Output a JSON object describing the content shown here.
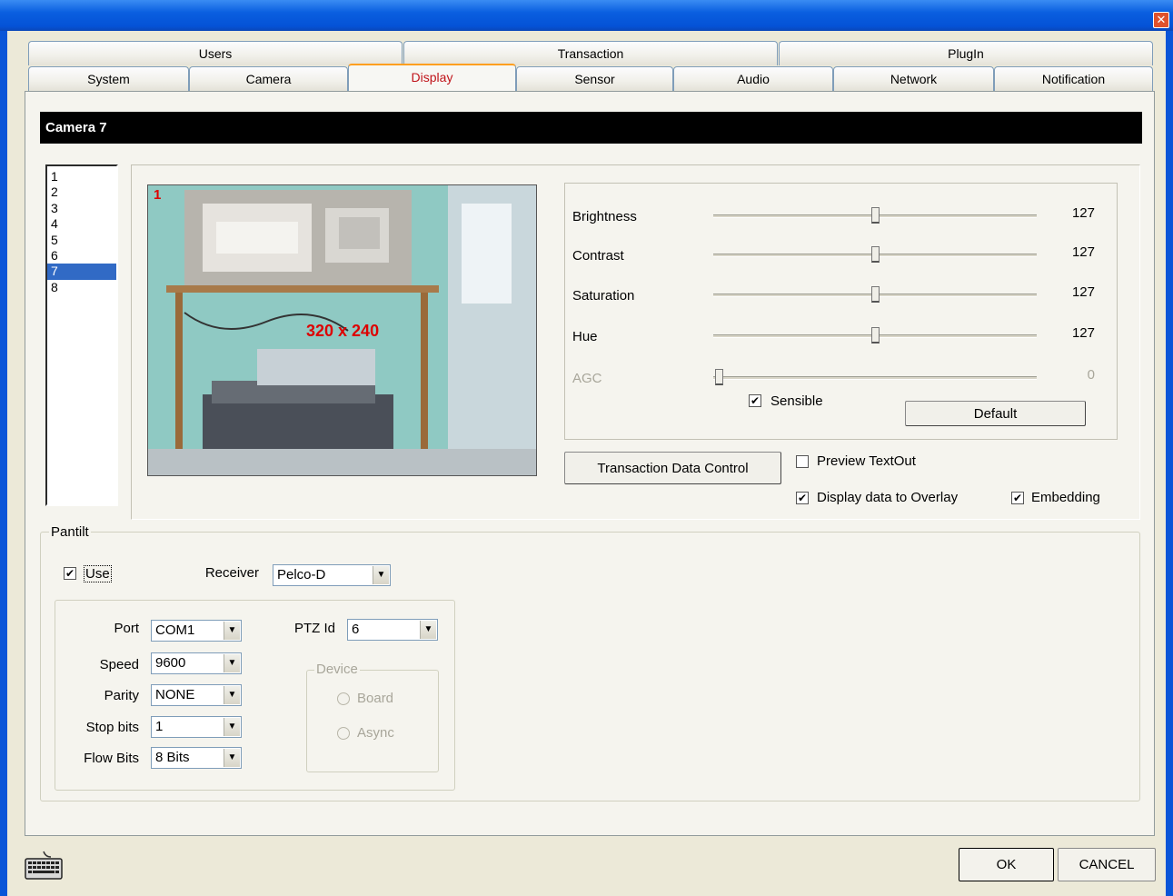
{
  "window": {
    "close_glyph": "✕"
  },
  "tabs_row1": [
    "Users",
    "Transaction",
    "PlugIn"
  ],
  "tabs_row2": [
    "System",
    "Camera",
    "Display",
    "Sensor",
    "Audio",
    "Network",
    "Notification"
  ],
  "camera_header": "Camera 7",
  "camera_list": [
    "1",
    "2",
    "3",
    "4",
    "5",
    "6",
    "7",
    "8"
  ],
  "camera_list_selected": "7",
  "preview": {
    "channel": "1",
    "resolution": "320 x 240"
  },
  "sliders": [
    {
      "label": "Brightness",
      "value": "127",
      "level": 0.5,
      "enabled": true
    },
    {
      "label": "Contrast",
      "value": "127",
      "level": 0.5,
      "enabled": true
    },
    {
      "label": "Saturation",
      "value": "127",
      "level": 0.5,
      "enabled": true
    },
    {
      "label": "Hue",
      "value": "127",
      "level": 0.5,
      "enabled": true
    },
    {
      "label": "AGC",
      "value": "0",
      "level": 0.0,
      "enabled": false
    }
  ],
  "sensible": {
    "label": "Sensible",
    "checked": true
  },
  "default_button": "Default",
  "transaction_button": "Transaction Data Control",
  "preview_textout": {
    "label": "Preview TextOut",
    "checked": false
  },
  "display_overlay": {
    "label": "Display data to Overlay",
    "checked": true
  },
  "embedding": {
    "label": "Embedding",
    "checked": true
  },
  "pantilt": {
    "legend": "Pantilt",
    "use": {
      "label": "Use",
      "checked": true
    },
    "receiver_label": "Receiver",
    "receiver_value": "Pelco-D",
    "port_label": "Port",
    "port_value": "COM1",
    "speed_label": "Speed",
    "speed_value": "9600",
    "parity_label": "Parity",
    "parity_value": "NONE",
    "stopbits_label": "Stop bits",
    "stopbits_value": "1",
    "flowbits_label": "Flow Bits",
    "flowbits_value": "8 Bits",
    "ptzid_label": "PTZ Id",
    "ptzid_value": "6",
    "device_legend": "Device",
    "device_board": "Board",
    "device_async": "Async"
  },
  "footer": {
    "ok": "OK",
    "cancel": "CANCEL"
  },
  "colors": {
    "title_bar": "#0a5fe0",
    "active_tab_text": "#c0141a",
    "selection": "#316ac5",
    "header_bg": "#000000"
  }
}
